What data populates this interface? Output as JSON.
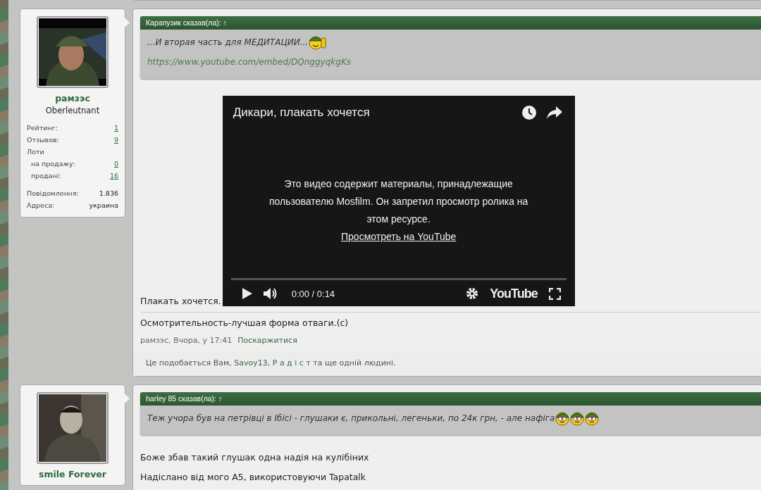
{
  "posts": [
    {
      "author": {
        "name": "рамзэс",
        "rank": "Oberleutnant",
        "stats": [
          {
            "label": "Рейтинг:",
            "value": "1",
            "link": true
          },
          {
            "label": "Отзывов:",
            "value": "9",
            "link": true
          },
          {
            "label": "Лоти",
            "children": [
              {
                "label": "на продажу:",
                "value": "0",
                "link": true
              },
              {
                "label": "продані:",
                "value": "16",
                "link": true
              }
            ]
          }
        ],
        "details": [
          {
            "label": "Повідомлення:",
            "value": "1.836",
            "link": false
          },
          {
            "label": "Адреса:",
            "value": "украина",
            "link": false
          }
        ]
      },
      "quote": {
        "header": "Карапузик сказав(ла): ↑",
        "lines": [
          {
            "kind": "text",
            "text": "...И вторая часть для МЕДИТАЦИИ...",
            "emoticons": [
              {
                "kind": "thumbs"
              }
            ]
          },
          {
            "kind": "link",
            "text": "https://www.youtube.com/embed/DQnggyqkgKs"
          }
        ]
      },
      "body": [
        {
          "kind": "text-with-video",
          "text": "Плакать хочется.",
          "video": {
            "title": "Дикари, плакать хочется",
            "message": "Это видео содержит материалы, принадлежащие пользователю Mosfilm. Он запретил просмотр ролика на этом ресурсе.",
            "link": "Просмотреть на YouTube",
            "time": "0:00 / 0:14",
            "brand": "YouTube",
            "level": 0
          }
        }
      ],
      "signature": "Осмотрительность-лучшая форма отваги.(c)",
      "meta": {
        "byline": "рамзэс, Вчора, у 17:41",
        "report": "Поскаржитися"
      },
      "likes": [
        {
          "kind": "text",
          "text": "Це подобається Вам, "
        },
        {
          "kind": "link",
          "text": "Savoy13"
        },
        {
          "kind": "text",
          "text": ", "
        },
        {
          "kind": "link",
          "text": "Р а д і с т"
        },
        {
          "kind": "text",
          "text": " та ще одній людині."
        }
      ]
    },
    {
      "author": {
        "name": "smile Forever"
      },
      "quote": {
        "header": "harley 85 сказав(ла): ↑",
        "lines": [
          {
            "kind": "text",
            "text": "Теж учора був на петрівці в Ібісі - глушаки є, прикольні, легеньки, по 24к грн, - але нафіга ",
            "emoticons": [
              {
                "kind": "dizzy"
              },
              {
                "kind": "dizzy"
              },
              {
                "kind": "dizzy"
              }
            ]
          }
        ]
      },
      "body": [
        {
          "kind": "text",
          "text": "Боже збав такий глушак одна надія на кулібіних"
        },
        {
          "kind": "text",
          "text": "Надіслано від мого A5, використовуючи Tapatalk"
        }
      ]
    }
  ]
}
